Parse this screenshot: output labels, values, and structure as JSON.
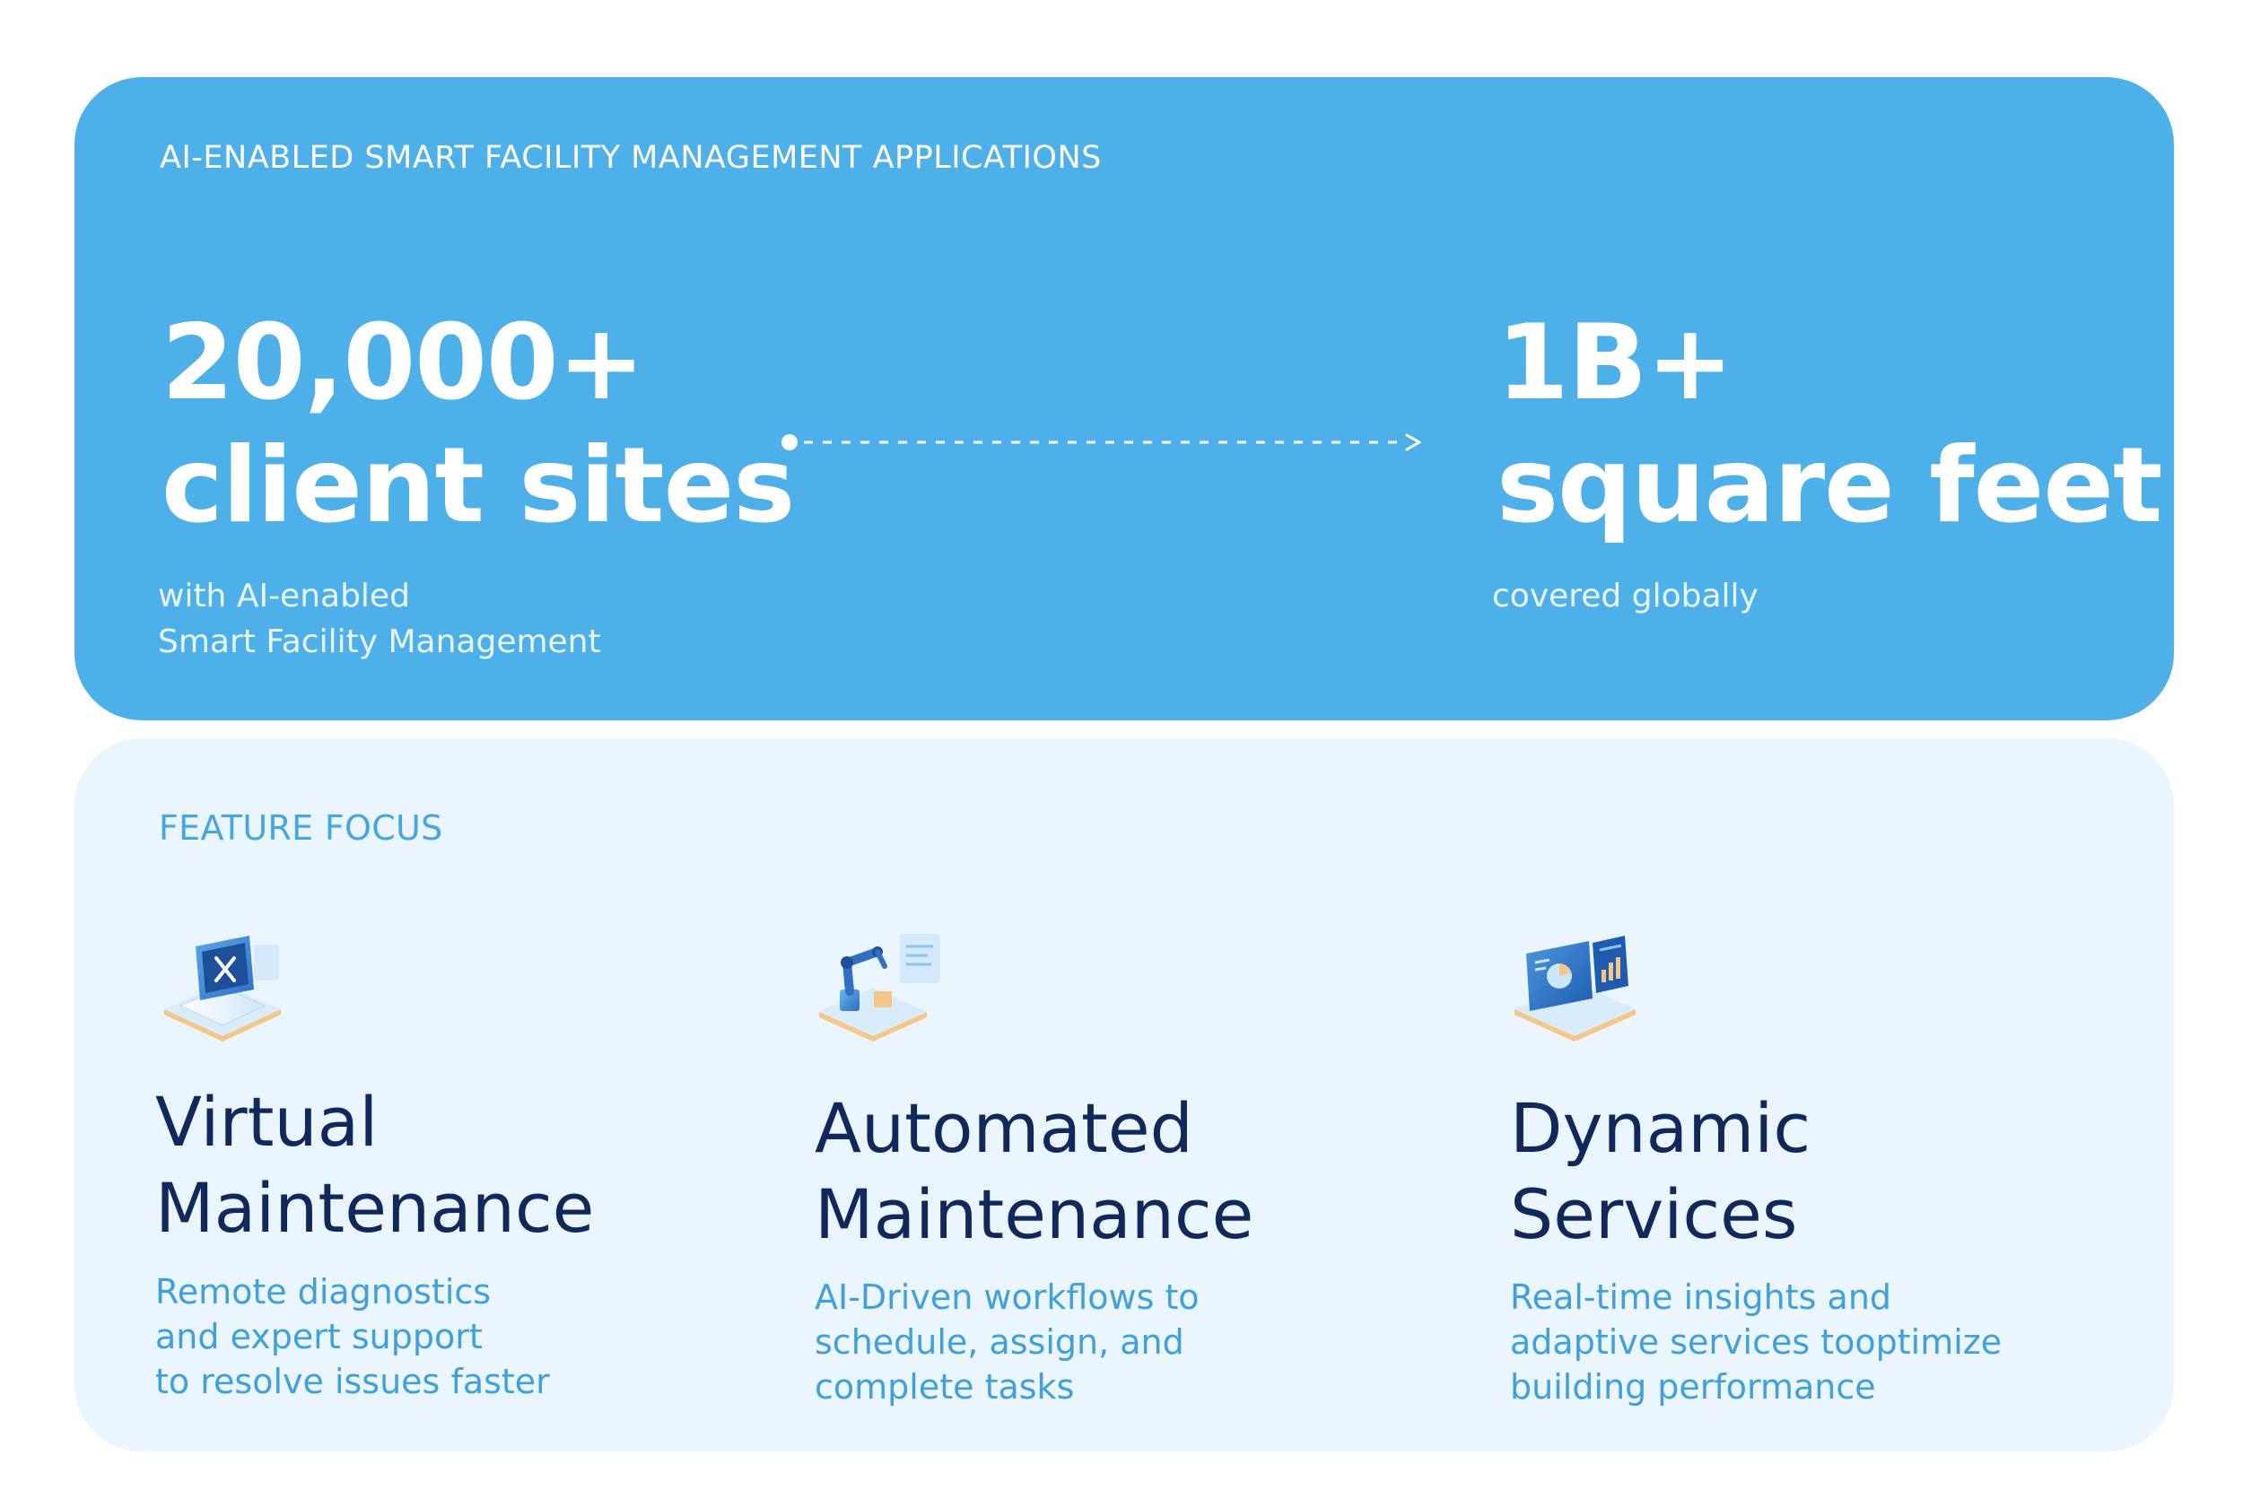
{
  "stats": {
    "eyebrow": "AI-ENABLED SMART FACILITY MANAGEMENT APPLICATIONS",
    "left": {
      "big_lines": [
        "20,000+",
        "client sites"
      ],
      "sub_lines": [
        "with AI-enabled",
        "Smart Facility Management"
      ]
    },
    "right": {
      "big_lines": [
        "1B+",
        "square feet"
      ],
      "sub_lines": [
        "covered globally"
      ]
    },
    "connector_icon": "dashed-arrow-icon"
  },
  "features": {
    "eyebrow": "FEATURE FOCUS",
    "items": [
      {
        "icon": "laptop-tools-icon",
        "title_lines": [
          "Virtual",
          "Maintenance"
        ],
        "desc_lines": [
          "Remote diagnostics",
          "and expert support",
          "to resolve issues faster"
        ]
      },
      {
        "icon": "robot-arm-icon",
        "title_lines": [
          "Automated",
          "Maintenance"
        ],
        "desc_lines": [
          "AI-Driven workflows to",
          "schedule, assign, and",
          "complete tasks"
        ]
      },
      {
        "icon": "dashboard-charts-icon",
        "title_lines": [
          "Dynamic",
          "Services"
        ],
        "desc_lines": [
          "Real-time insights and",
          "adaptive services tooptimize",
          "building performance"
        ]
      }
    ]
  },
  "colors": {
    "stats_bg": "#4eb0e8",
    "feature_bg": "#eaf5fd",
    "title_navy": "#11285a",
    "accent_blue": "#3fa0dc"
  }
}
